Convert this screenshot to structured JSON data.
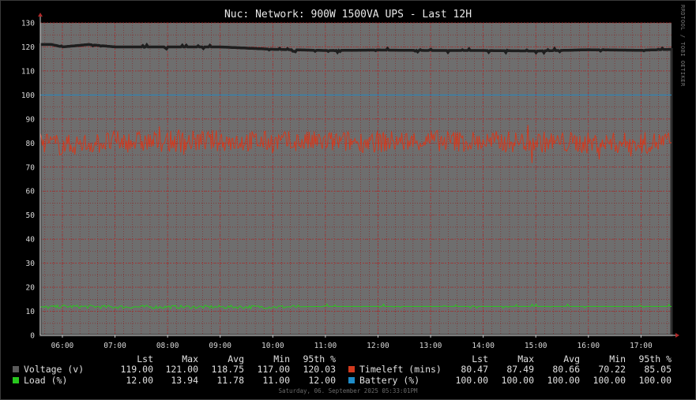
{
  "title": "Nuc: Network: 900W 1500VA UPS - Last 12H",
  "side_label": "RRDTOOL / TOBI OETIKER",
  "footer": "Saturday, 06. September 2025 05:33:01PM",
  "colors": {
    "background": "#000000",
    "plot_area": "#6e6e6e",
    "voltage": "#2e2e2e",
    "timeleft": "#d23a1e",
    "load": "#28c81e",
    "battery": "#1e8cc8",
    "grid": "#8a1f1f"
  },
  "chart_data": {
    "type": "area",
    "title": "Nuc: Network: 900W 1500VA UPS - Last 12H",
    "ylim": [
      0,
      130
    ],
    "yticks": [
      0,
      10,
      20,
      30,
      40,
      50,
      60,
      70,
      80,
      90,
      100,
      110,
      120,
      130
    ],
    "xlim": [
      5.58,
      17.58
    ],
    "x_labels": [
      "06:00",
      "07:00",
      "08:00",
      "09:00",
      "10:00",
      "11:00",
      "12:00",
      "13:00",
      "14:00",
      "15:00",
      "16:00",
      "17:00"
    ],
    "x_label_hours": [
      6,
      7,
      8,
      9,
      10,
      11,
      12,
      13,
      14,
      15,
      16,
      17
    ],
    "grid": true,
    "series": [
      {
        "name": "Voltage (v)",
        "kind": "area",
        "color": "#2e2e2e",
        "approx_level": [
          [
            5.58,
            121
          ],
          [
            5.8,
            121
          ],
          [
            6.0,
            120
          ],
          [
            6.5,
            121
          ],
          [
            7.0,
            120
          ],
          [
            8.0,
            120
          ],
          [
            9.0,
            120
          ],
          [
            10.0,
            119
          ],
          [
            11.0,
            118.5
          ],
          [
            12.0,
            118.7
          ],
          [
            13.0,
            118.5
          ],
          [
            14.0,
            118.5
          ],
          [
            15.0,
            118.3
          ],
          [
            16.0,
            118.8
          ],
          [
            17.0,
            118.6
          ],
          [
            17.58,
            119
          ]
        ],
        "stats": {
          "lst": "119.00",
          "max": "121.00",
          "avg": "118.75",
          "min": "117.00",
          "p95": "120.03"
        }
      },
      {
        "name": "Timeleft (mins)",
        "kind": "line",
        "color": "#d23a1e",
        "approx_level": [
          [
            5.58,
            80.5
          ],
          [
            6.0,
            79
          ],
          [
            7.0,
            80.5
          ],
          [
            8.0,
            80.5
          ],
          [
            9.0,
            81
          ],
          [
            10.0,
            80.5
          ],
          [
            11.0,
            80.5
          ],
          [
            12.0,
            80.5
          ],
          [
            13.0,
            81
          ],
          [
            14.0,
            80.5
          ],
          [
            15.0,
            80.5
          ],
          [
            16.0,
            80
          ],
          [
            17.0,
            80
          ],
          [
            17.58,
            80.47
          ]
        ],
        "stats": {
          "lst": "80.47",
          "max": "87.49",
          "avg": "80.66",
          "min": "70.22",
          "p95": "85.05"
        }
      },
      {
        "name": "Load (%)",
        "kind": "line",
        "color": "#28c81e",
        "approx_level": [
          [
            5.58,
            11.5
          ],
          [
            6.0,
            12
          ],
          [
            7.0,
            11.8
          ],
          [
            8.0,
            11.8
          ],
          [
            9.0,
            11.8
          ],
          [
            10.0,
            11.8
          ],
          [
            11.0,
            12
          ],
          [
            12.0,
            12
          ],
          [
            13.0,
            12
          ],
          [
            14.0,
            12
          ],
          [
            15.0,
            12
          ],
          [
            16.0,
            12
          ],
          [
            17.0,
            12
          ],
          [
            17.58,
            12
          ]
        ],
        "stats": {
          "lst": "12.00",
          "max": "13.94",
          "avg": "11.78",
          "min": "11.00",
          "p95": "12.00"
        }
      },
      {
        "name": "Battery (%)",
        "kind": "line",
        "color": "#1e8cc8",
        "approx_level": [
          [
            5.58,
            100
          ],
          [
            17.58,
            100
          ]
        ],
        "stats": {
          "lst": "100.00",
          "max": "100.00",
          "avg": "100.00",
          "min": "100.00",
          "p95": "100.00"
        }
      }
    ]
  },
  "legend": {
    "headers": [
      "Lst",
      "Max",
      "Avg",
      "Min",
      "95th %"
    ]
  }
}
